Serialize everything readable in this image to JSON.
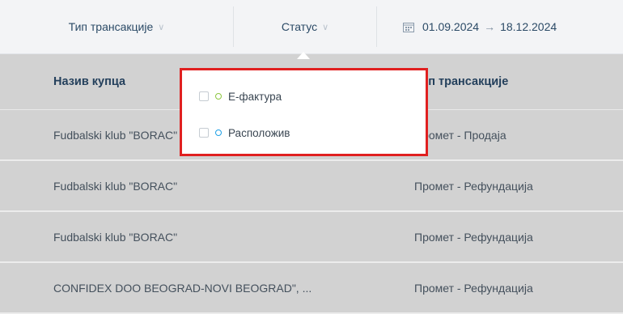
{
  "filters": {
    "transaction_type_label": "Тип трансакције",
    "status_label": "Статус",
    "date_from": "01.09.2024",
    "date_arrow": "→",
    "date_to": "18.12.2024"
  },
  "table": {
    "columns": [
      "Назив купца",
      "Тип трансакције"
    ],
    "rows": [
      {
        "customer": "Fudbalski klub \"BORAC\"",
        "type": "Промет - Продаја"
      },
      {
        "customer": "Fudbalski klub \"BORAC\"",
        "type": "Промет - Рефундација"
      },
      {
        "customer": "Fudbalski klub \"BORAC\"",
        "type": "Промет - Рефундација"
      },
      {
        "customer": "CONFIDEX DOO BEOGRAD-NOVI BEOGRAD\", ...",
        "type": "Промет - Рефундација"
      }
    ]
  },
  "status_dropdown": {
    "options": [
      {
        "label": "Е-фактура",
        "color": "#8cc63f"
      },
      {
        "label": "Расположив",
        "color": "#1ea0e6"
      }
    ]
  },
  "colors": {
    "highlight_border": "#e02020"
  }
}
